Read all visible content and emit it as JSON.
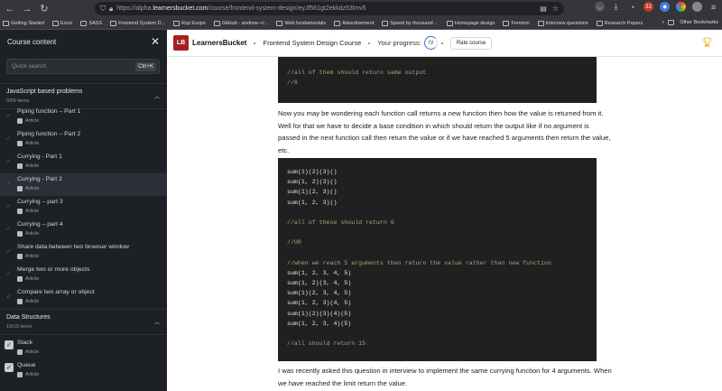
{
  "browser": {
    "url_prefix": "https://alpha.",
    "url_domain": "learnersbucket.com",
    "url_path": "/course/frontend-system-design/eyJf561gt2ekkdz53lmv5",
    "bookmarks": [
      "Getting Started",
      "Ezoic",
      "SASS",
      "Frontend System D...",
      "Rzp Esops",
      "GitHub - andrew--r/...",
      "Web fundamentals",
      "Advertisement",
      "Speed by thousand ...",
      "Homepage design",
      "Fermion",
      "Interview questions",
      "Research Papers"
    ],
    "other_bookmarks": "Other Bookmarks",
    "badge_count": "32"
  },
  "sidebar": {
    "title": "Course content",
    "search_placeholder": "Quick search",
    "shortcut": "Ctrl+K",
    "sections": [
      {
        "title": "JavaScript based problems",
        "count": "0/59 items",
        "items": [
          {
            "name": "Piping function – Part 1",
            "type": "Article"
          },
          {
            "name": "Piping function – Part 2",
            "type": "Article"
          },
          {
            "name": "Currying - Part 1",
            "type": "Article"
          },
          {
            "name": "Currying - Part 2",
            "type": "Article"
          },
          {
            "name": "Currying – part 3",
            "type": "Article"
          },
          {
            "name": "Currying – part 4",
            "type": "Article"
          },
          {
            "name": "Share data between two browser window",
            "type": "Article"
          },
          {
            "name": "Merge two or more objects",
            "type": "Article"
          },
          {
            "name": "Compare two array or object",
            "type": "Article"
          }
        ]
      },
      {
        "title": "Data Structures",
        "count": "19/19 items",
        "items": [
          {
            "name": "Stack",
            "type": "Article"
          },
          {
            "name": "Queue",
            "type": "Article"
          }
        ]
      }
    ]
  },
  "header": {
    "brand": "LearnersBucket",
    "logo": "LB",
    "course_title": "Frontend System Design Course",
    "progress_label": "Your progress:",
    "progress_value": "72",
    "rate_button": "Rate course"
  },
  "content": {
    "code_top": [
      "//all of them should return same output",
      "//6"
    ],
    "para1": "Now you may be wondering each function call returns a new function then how the value is returned from it. Well for that we have to decide a base condition in which should return the output like if no argument is passed in the next function call then return the value or if we have reached 5 arguments then return the value, etc.",
    "code_main": [
      "sum(1)(2)(3)()",
      "sum(1, 2)(3)()",
      "sum(1)(2, 3)()",
      "sum(1, 2, 3)()",
      "",
      "//all of these should return 6",
      "",
      "//OR",
      "",
      "//when we reach 5 arguments then return the value rather than new function",
      "sum(1, 2, 3, 4, 5)",
      "sum(1, 2)(3, 4, 5)",
      "sum(1)(2, 3, 4, 5)",
      "sum(1, 2, 3)(4, 5)",
      "sum(1)(2)(3)(4)(5)",
      "sum(1, 2, 3, 4)(5)",
      "",
      "//all should return 15"
    ],
    "para2": "I was recently asked this question in interview to implement the same  currying function for 4 arguments. When we have reached the limit  return the value."
  }
}
